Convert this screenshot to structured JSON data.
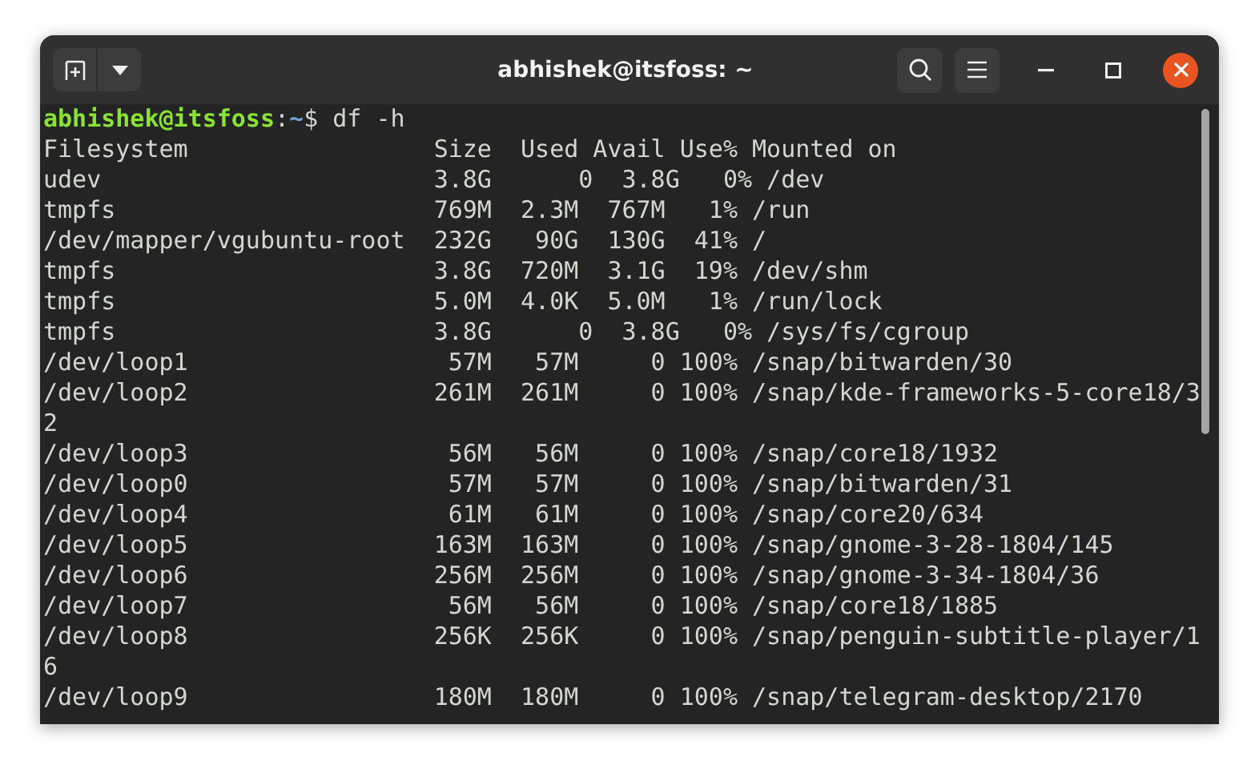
{
  "window": {
    "title": "abhishek@itsfoss: ~"
  },
  "terminal": {
    "prompt": [
      {
        "kind": "user",
        "text": "abhishek@itsfoss"
      },
      {
        "kind": "plain",
        "text": ":"
      },
      {
        "kind": "path",
        "text": "~"
      },
      {
        "kind": "plain",
        "text": "$ df -h"
      }
    ],
    "lines": [
      "Filesystem                 Size  Used Avail Use% Mounted on",
      "udev                       3.8G      0  3.8G   0% /dev",
      "tmpfs                      769M  2.3M  767M   1% /run",
      "/dev/mapper/vgubuntu-root  232G   90G  130G  41% /",
      "tmpfs                      3.8G  720M  3.1G  19% /dev/shm",
      "tmpfs                      5.0M  4.0K  5.0M   1% /run/lock",
      "tmpfs                      3.8G      0  3.8G   0% /sys/fs/cgroup",
      "/dev/loop1                  57M   57M     0 100% /snap/bitwarden/30",
      "/dev/loop2                 261M  261M     0 100% /snap/kde-frameworks-5-core18/3",
      "2",
      "/dev/loop3                  56M   56M     0 100% /snap/core18/1932",
      "/dev/loop0                  57M   57M     0 100% /snap/bitwarden/31",
      "/dev/loop4                  61M   61M     0 100% /snap/core20/634",
      "/dev/loop5                 163M  163M     0 100% /snap/gnome-3-28-1804/145",
      "/dev/loop6                 256M  256M     0 100% /snap/gnome-3-34-1804/36",
      "/dev/loop7                  56M   56M     0 100% /snap/core18/1885",
      "/dev/loop8                 256K  256K     0 100% /snap/penguin-subtitle-player/1",
      "6",
      "/dev/loop9                 180M  180M     0 100% /snap/telegram-desktop/2170"
    ]
  }
}
